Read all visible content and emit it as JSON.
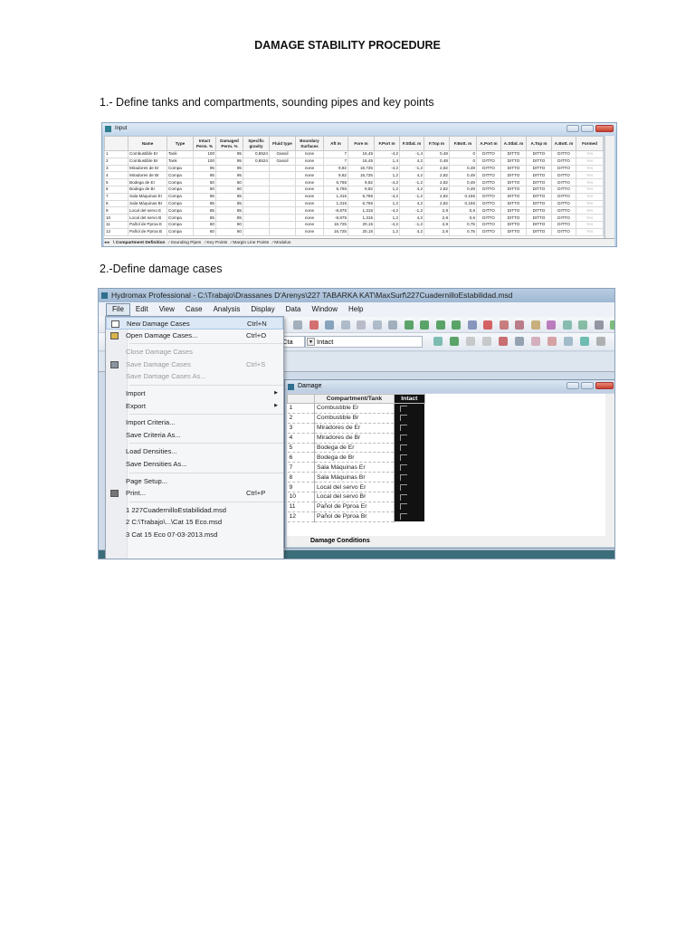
{
  "document": {
    "title": "DAMAGE STABILITY PROCEDURE",
    "step1": "1.- Define tanks and compartments, sounding pipes and key points",
    "step2": "2.-Define damage cases"
  },
  "input_window": {
    "title": "Input",
    "columns": [
      "",
      "Name",
      "Type",
      "Intact Perm. %",
      "Damaged Perm. %",
      "Specific gravity",
      "Fluid type",
      "Boundary Surfaces",
      "Aft m",
      "Fore m",
      "F.Port m",
      "F.Stbd. m",
      "F.Top m",
      "F.Bott. m",
      "A.Port m",
      "A.Stbd. m",
      "A.Top m",
      "A.Bott. m",
      "Formed"
    ],
    "rows": [
      [
        "1",
        "Combustible Er",
        "Tank",
        "100",
        "95",
        "0,8524",
        "Gasoil",
        "none",
        "7",
        "16,45",
        "-4,2",
        "-1,4",
        "0,48",
        "0",
        "DITTO",
        "DITTO",
        "DITTO",
        "DITTO",
        "Yes"
      ],
      [
        "2",
        "Combustible Br",
        "Tank",
        "100",
        "95",
        "0,8524",
        "Gasoil",
        "none",
        "7",
        "16,45",
        "1,4",
        "4,2",
        "0,48",
        "0",
        "DITTO",
        "DITTO",
        "DITTO",
        "DITTO",
        "Yes"
      ],
      [
        "3",
        "Miradores de Er",
        "Compa",
        "95",
        "95",
        "",
        "",
        "none",
        "9,82",
        "16,725",
        "-4,2",
        "-1,2",
        "2,82",
        "0,49",
        "DITTO",
        "DITTO",
        "DITTO",
        "DITTO",
        "Yes"
      ],
      [
        "4",
        "Miradores de Br",
        "Compa",
        "95",
        "95",
        "",
        "",
        "none",
        "9,82",
        "16,725",
        "1,2",
        "4,2",
        "2,82",
        "0,49",
        "DITTO",
        "DITTO",
        "DITTO",
        "DITTO",
        "Yes"
      ],
      [
        "5",
        "Bodega de Er",
        "Compa",
        "60",
        "60",
        "",
        "",
        "none",
        "6,765",
        "9,82",
        "-4,2",
        "-1,2",
        "2,82",
        "0,49",
        "DITTO",
        "DITTO",
        "DITTO",
        "DITTO",
        "Yes"
      ],
      [
        "6",
        "Bodega de Br",
        "Compa",
        "60",
        "60",
        "",
        "",
        "none",
        "6,765",
        "9,82",
        "1,2",
        "4,2",
        "2,82",
        "0,49",
        "DITTO",
        "DITTO",
        "DITTO",
        "DITTO",
        "Yes"
      ],
      [
        "7",
        "Sala Máquinas Er",
        "Compa",
        "85",
        "85",
        "",
        "",
        "none",
        "1,315",
        "6,765",
        "-4,2",
        "-1,2",
        "2,82",
        "0,155",
        "DITTO",
        "DITTO",
        "DITTO",
        "DITTO",
        "Yes"
      ],
      [
        "8",
        "Sala Máquinas Br",
        "Compa",
        "85",
        "85",
        "",
        "",
        "none",
        "1,315",
        "6,765",
        "1,2",
        "4,2",
        "2,82",
        "0,155",
        "DITTO",
        "DITTO",
        "DITTO",
        "DITTO",
        "Yes"
      ],
      [
        "9",
        "Local del servo E",
        "Compa",
        "85",
        "85",
        "",
        "",
        "none",
        "-8,875",
        "1,315",
        "-4,2",
        "-1,2",
        "2,8",
        "0,6",
        "DITTO",
        "DITTO",
        "DITTO",
        "DITTO",
        "Yes"
      ],
      [
        "10",
        "Local del servo B",
        "Compa",
        "85",
        "85",
        "",
        "",
        "none",
        "-8,875",
        "1,315",
        "1,2",
        "4,2",
        "2,8",
        "0,6",
        "DITTO",
        "DITTO",
        "DITTO",
        "DITTO",
        "Yes"
      ],
      [
        "11",
        "Pañol de Pproa E",
        "Compa",
        "60",
        "60",
        "",
        "",
        "none",
        "16,725",
        "20,15",
        "-4,2",
        "-1,2",
        "2,8",
        "0,75",
        "DITTO",
        "DITTO",
        "DITTO",
        "DITTO",
        "Yes"
      ],
      [
        "12",
        "Pañol de Pproa B",
        "Compa",
        "60",
        "60",
        "",
        "",
        "none",
        "16,725",
        "20,15",
        "1,2",
        "4,2",
        "2,8",
        "0,75",
        "DITTO",
        "DITTO",
        "DITTO",
        "DITTO",
        "Yes"
      ]
    ],
    "tabs": [
      "Compartment Definition",
      "Sounding Pipes",
      "Key Points",
      "Margin Line Points",
      "Modulus"
    ]
  },
  "app": {
    "title": "Hydromax Professional - C:\\Trabajo\\Drassanes D'Arenys\\227 TABARKA KAT\\MaxSurf\\227CuadernilloEstabilidad.msd",
    "menus": [
      "File",
      "Edit",
      "View",
      "Case",
      "Analysis",
      "Display",
      "Data",
      "Window",
      "Help"
    ],
    "combo_left": "Cta",
    "combo_case": "Intact",
    "file_menu": [
      {
        "label": "New Damage Cases",
        "shortcut": "Ctrl+N",
        "icon": "new-document-icon"
      },
      {
        "label": "Open Damage Cases...",
        "shortcut": "Ctrl+O",
        "icon": "folder-open-icon"
      },
      {
        "sep": true
      },
      {
        "label": "Close Damage Cases",
        "disabled": true
      },
      {
        "label": "Save Damage Cases",
        "shortcut": "Ctrl+S",
        "disabled": true,
        "icon": "save-icon"
      },
      {
        "label": "Save Damage Cases As...",
        "disabled": true
      },
      {
        "sep": true
      },
      {
        "label": "Import",
        "submenu": true
      },
      {
        "label": "Export",
        "submenu": true
      },
      {
        "sep": true
      },
      {
        "label": "Import Criteria..."
      },
      {
        "label": "Save Criteria As..."
      },
      {
        "sep": true
      },
      {
        "label": "Load Densities..."
      },
      {
        "label": "Save Densities As..."
      },
      {
        "sep": true
      },
      {
        "label": "Page Setup..."
      },
      {
        "label": "Print...",
        "shortcut": "Ctrl+P",
        "icon": "printer-icon"
      },
      {
        "sep": true
      },
      {
        "label": "1 227CuadernilloEstabilidad.msd"
      },
      {
        "label": "2 C:\\Trabajo\\...\\Cat 15 Eco.msd"
      },
      {
        "label": "3 Cat 15 Eco 07-03-2013.msd"
      }
    ],
    "damage_window": {
      "title": "Damage",
      "columns": [
        "",
        "Compartment/Tank",
        "Intact"
      ],
      "rows": [
        "Combustible Er",
        "Combustible Br",
        "Miradores de Er",
        "Miradores de Br",
        "Bodega de Er",
        "Bodega de Br",
        "Sala Máquinas Er",
        "Sala Máquinas Br",
        "Local del servo Er",
        "Local del servo Br",
        "Pañol de Pproa Er",
        "Pañol de Pproa Br"
      ],
      "tab": "Damage Conditions"
    }
  }
}
